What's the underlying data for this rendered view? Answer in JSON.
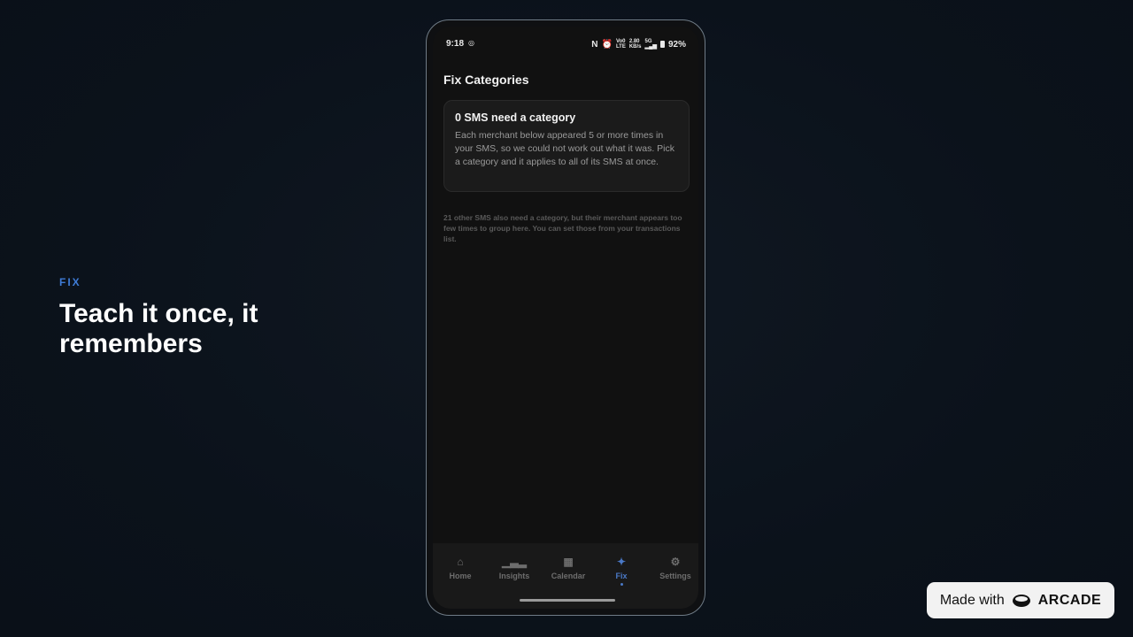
{
  "caption": {
    "eyebrow": "FIX",
    "headline": "Teach it once, it remembers"
  },
  "statusbar": {
    "time": "9:18",
    "network_top": "2.80",
    "network_bottom": "KB/s",
    "volte_top": "Vo0",
    "volte_bottom": "LTE",
    "signal": "5G",
    "battery": "92%"
  },
  "screen": {
    "title": "Fix Categories",
    "card": {
      "title": "0 SMS need a category",
      "body": "Each merchant below appeared 5 or more times in your SMS, so we could not work out what it was. Pick a category and it applies to all of its SMS at once."
    },
    "note": "21 other SMS also need a category, but their merchant appears too few times to group here. You can set those from your transactions list."
  },
  "nav": {
    "items": [
      {
        "label": "Home",
        "icon": "home-icon",
        "active": false
      },
      {
        "label": "Insights",
        "icon": "bar-chart-icon",
        "active": false
      },
      {
        "label": "Calendar",
        "icon": "calendar-icon",
        "active": false
      },
      {
        "label": "Fix",
        "icon": "magic-wand-icon",
        "active": true
      },
      {
        "label": "Settings",
        "icon": "gear-icon",
        "active": false
      }
    ],
    "active_color": "#4a79c7"
  },
  "badge": {
    "made_with": "Made with",
    "brand": "ARCADE"
  }
}
